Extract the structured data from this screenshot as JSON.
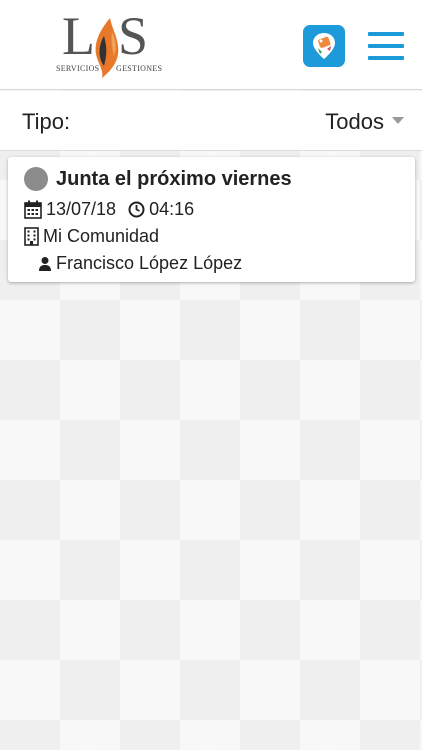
{
  "header": {
    "logo": {
      "letter_left": "L",
      "letter_right": "S",
      "sub_left": "SERVICIOS",
      "sub_right": "GESTIONES"
    },
    "app_badge_icon": "map-pin-tag-icon",
    "menu_icon": "hamburger-menu-icon",
    "accent_color": "#1d9ad9"
  },
  "filter": {
    "label": "Tipo:",
    "selected": "Todos"
  },
  "items": [
    {
      "title": "Junta el próximo viernes",
      "date": "13/07/18",
      "time": "04:16",
      "place": "Mi Comunidad",
      "person": "Francisco López López",
      "status_color": "#8c8c8c"
    }
  ]
}
